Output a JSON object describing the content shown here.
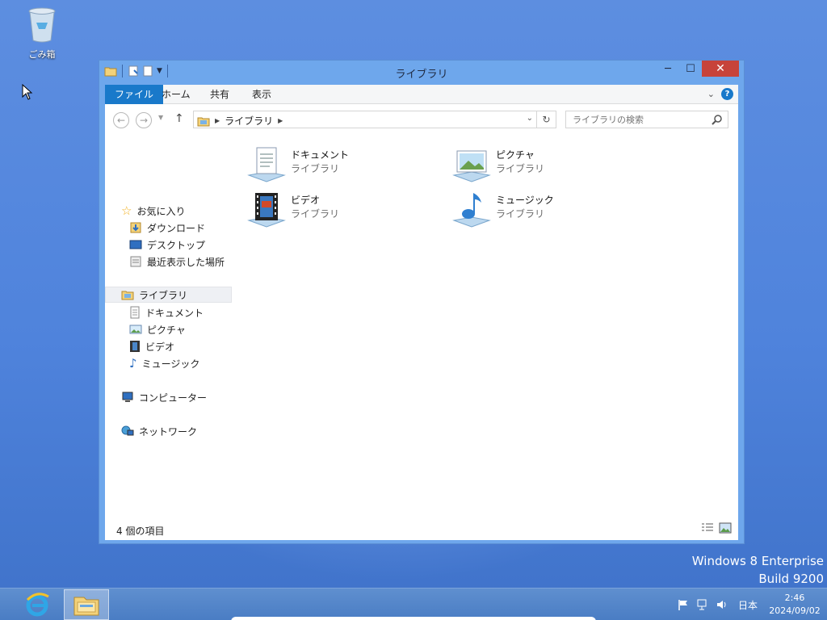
{
  "desktop": {
    "recycle_bin_label": "ごみ箱"
  },
  "window": {
    "title": "ライブラリ",
    "ribbon_tabs": [
      "ファイル",
      "ホーム",
      "共有",
      "表示"
    ],
    "address": {
      "path": "ライブラリ"
    },
    "search_placeholder": "ライブラリの検索",
    "nav": {
      "favorites": "お気に入り",
      "downloads": "ダウンロード",
      "desktop": "デスクトップ",
      "recent": "最近表示した場所",
      "libraries": "ライブラリ",
      "lib_documents": "ドキュメント",
      "lib_pictures": "ピクチャ",
      "lib_videos": "ビデオ",
      "lib_music": "ミュージック",
      "computer": "コンピューター",
      "network": "ネットワーク"
    },
    "items": [
      {
        "name": "ドキュメント",
        "type": "ライブラリ",
        "icon": "documents-library-icon"
      },
      {
        "name": "ピクチャ",
        "type": "ライブラリ",
        "icon": "pictures-library-icon"
      },
      {
        "name": "ビデオ",
        "type": "ライブラリ",
        "icon": "videos-library-icon"
      },
      {
        "name": "ミュージック",
        "type": "ライブラリ",
        "icon": "music-library-icon"
      }
    ],
    "status": "4 個の項目"
  },
  "watermark": {
    "line1": "Windows 8 Enterprise",
    "line2": "Build 9200"
  },
  "taskbar": {
    "language": "日本",
    "time": "2:46",
    "date": "2024/09/02"
  },
  "colors": {
    "accent": "#1979ca",
    "close": "#c7433a",
    "titlebar": "#6ea7ec"
  }
}
